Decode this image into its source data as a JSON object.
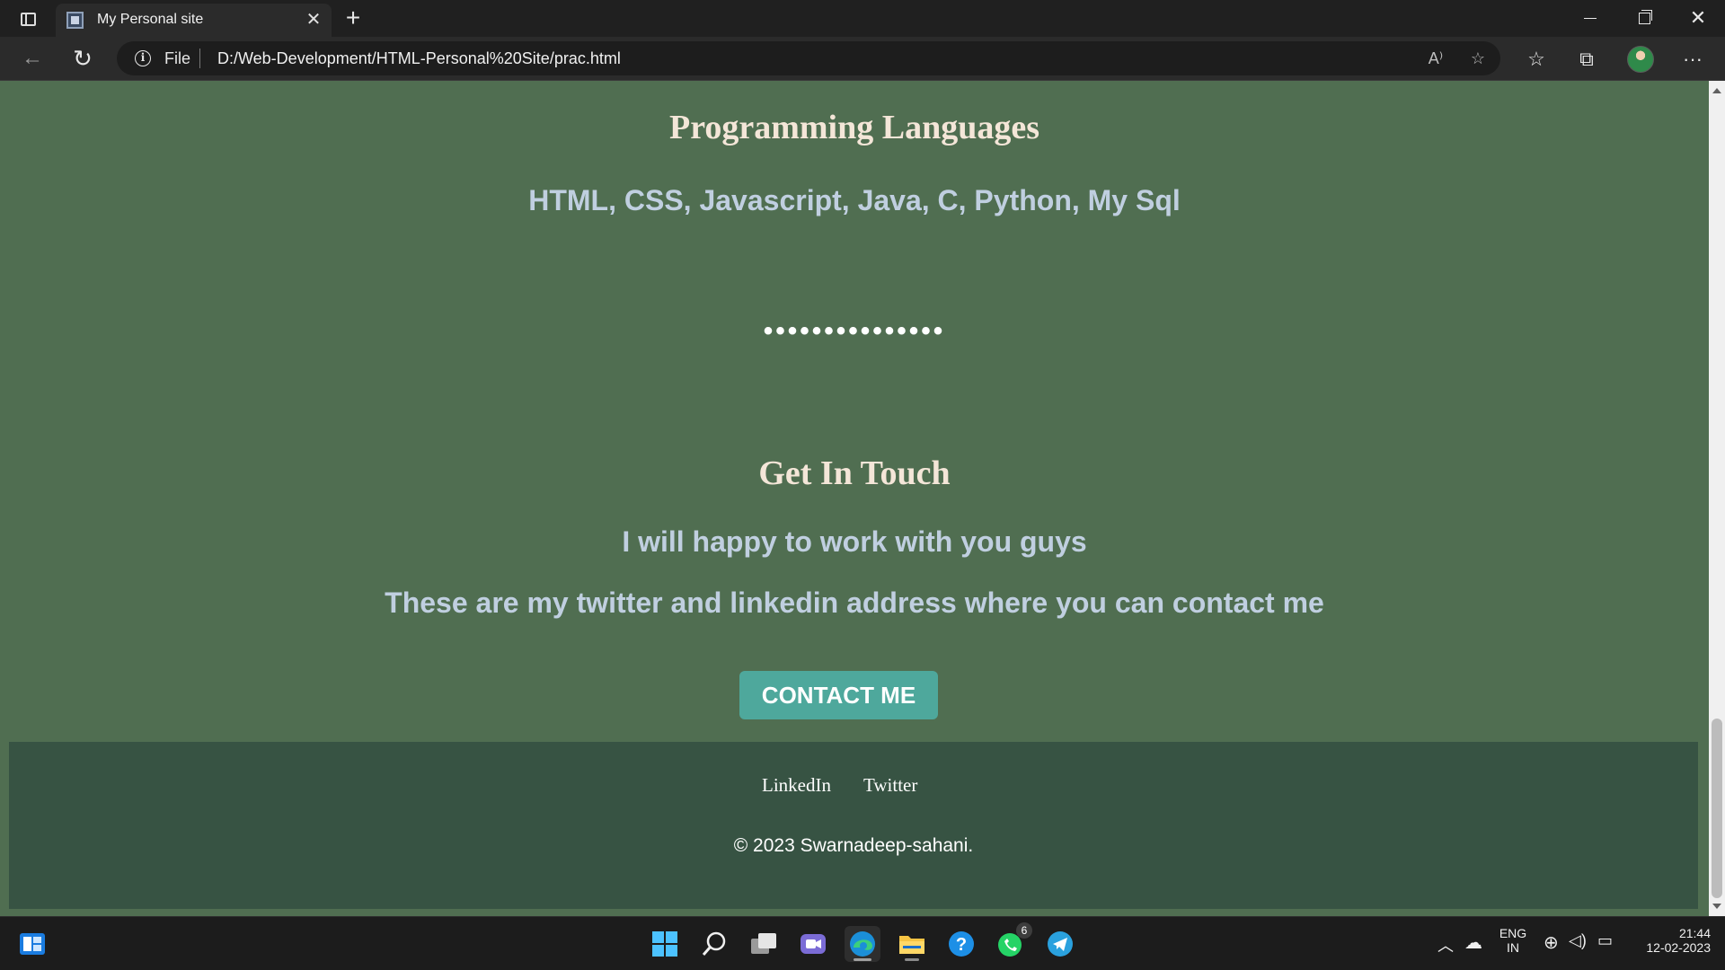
{
  "browser": {
    "tab_title": "My Personal site",
    "address": {
      "scheme_label": "File",
      "url": "D:/Web-Development/HTML-Personal%20Site/prac.html"
    }
  },
  "page": {
    "skills_heading": "Programming Languages",
    "skills_list": "HTML, CSS, Javascript, Java, C, Python, My Sql",
    "separator": "•••••••••••••••",
    "contact_heading": "Get In Touch",
    "contact_line1": "I will happy to work with you guys",
    "contact_line2": "These are my twitter and linkedin address where you can contact me",
    "contact_button": "CONTACT ME",
    "footer": {
      "links": [
        "LinkedIn",
        "Twitter"
      ],
      "copyright": "© 2023 Swarnadeep-sahani."
    }
  },
  "taskbar": {
    "whatsapp_badge": "6",
    "language_line1": "ENG",
    "language_line2": "IN",
    "time": "21:44",
    "date": "12-02-2023"
  },
  "colors": {
    "page_background": "#506e51",
    "footer_background": "#375343",
    "button_background": "#4ea89c",
    "heading_color": "#f4e6d8",
    "body_text_color": "#c0cfe0"
  }
}
